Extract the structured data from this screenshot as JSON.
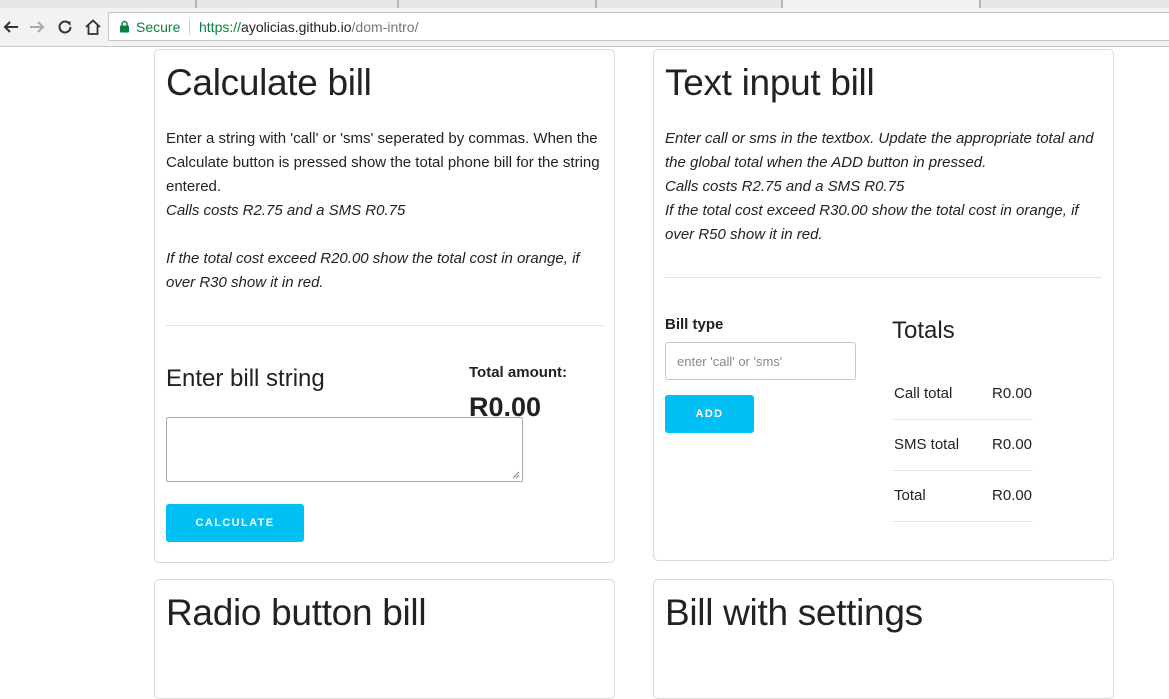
{
  "browser": {
    "secure_label": "Secure",
    "url_scheme": "https://",
    "url_host": "ayolicias.github.io",
    "url_path": "/dom-intro/"
  },
  "cards": {
    "calculate": {
      "title": "Calculate bill",
      "desc_text": "Enter a string with 'call' or 'sms' seperated by commas. When the Calculate button is pressed show the total phone bill for the string entered.",
      "desc_costs": "Calls costs R2.75 and a SMS R0.75",
      "desc_rule": "If the total cost exceed R20.00 show the total cost in orange, if over R30 show it in red.",
      "input_heading": "Enter bill string",
      "total_label": "Total amount:",
      "total_value": "R0.00",
      "button_label": "CALCULATE"
    },
    "text_input": {
      "title": "Text input bill",
      "desc_text": "Enter call or sms in the textbox. Update the appropriate total and the global total when the ADD button in pressed.",
      "desc_costs": "Calls costs R2.75 and a SMS R0.75",
      "desc_rule": "If the total cost exceed R30.00 show the total cost in orange, if over R50 show it in red.",
      "bill_type_label": "Bill type",
      "input_placeholder": "enter 'call' or 'sms'",
      "button_label": "ADD",
      "totals_heading": "Totals",
      "totals": [
        {
          "label": "Call total",
          "value": "R0.00"
        },
        {
          "label": "SMS total",
          "value": "R0.00"
        },
        {
          "label": "Total",
          "value": "R0.00"
        }
      ]
    },
    "radio": {
      "title": "Radio button bill"
    },
    "settings": {
      "title": "Bill with settings"
    }
  },
  "colors": {
    "accent": "#00bff3",
    "secure_green": "#0b8043"
  }
}
